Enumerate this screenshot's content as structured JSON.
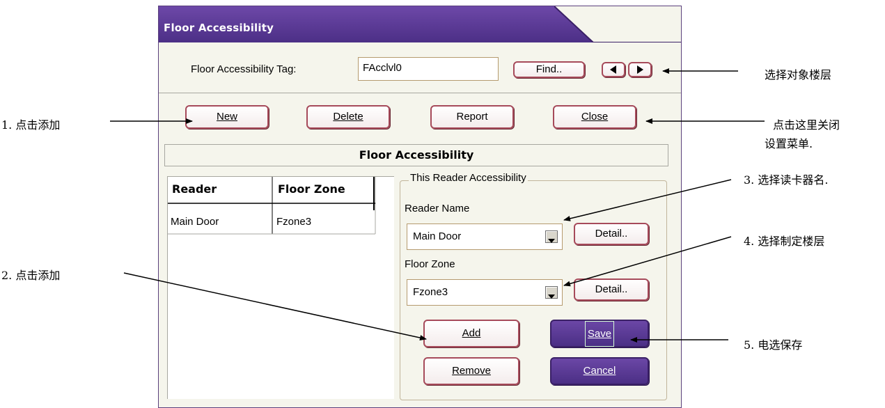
{
  "annotations": {
    "left_1": "1. 点击添加",
    "left_2": "2. 点击添加",
    "right_find": "选择对象楼层",
    "right_close_1": "点击这里关闭",
    "right_close_2": "设置菜单.",
    "right_3": "3.  选择读卡器名.",
    "right_4": "4.  选择制定楼层",
    "right_5": "5.  电选保存"
  },
  "window": {
    "title": "Floor Accessibility",
    "tag_label": "Floor Accessibility Tag:",
    "tag_value": "FAcclvl0",
    "find_label": "Find.."
  },
  "toolbar": {
    "new_label": "New",
    "delete_label": "Delete",
    "report_label": "Report",
    "close_label": "Close"
  },
  "panel": {
    "title": "Floor Accessibility",
    "table": {
      "headers": [
        "Reader",
        "Floor Zone"
      ],
      "rows": [
        [
          "Main Door",
          "Fzone3"
        ]
      ]
    },
    "group": {
      "legend": "This Reader Accessibility",
      "reader_name_label": "Reader Name",
      "reader_name_value": "Main Door",
      "floor_zone_label": "Floor Zone",
      "floor_zone_value": "Fzone3",
      "detail_label": "Detail..",
      "add_label": "Add",
      "remove_label": "Remove",
      "save_label": "Save",
      "cancel_label": "Cancel"
    }
  },
  "colors": {
    "titlebar": "#5a3a96",
    "button_border": "#a64a5a",
    "dark_button": "#5a3a96"
  }
}
